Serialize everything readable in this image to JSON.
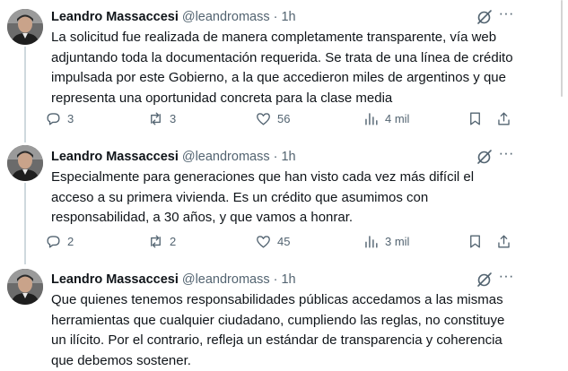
{
  "tweets": [
    {
      "author": "Leandro Massaccesi",
      "handle": "@leandromass",
      "separator": "·",
      "time": "1h",
      "text": "La solicitud fue realizada de manera completamente transparente, vía web adjuntando toda la documentación requerida. Se trata de una línea de crédito impulsada por este Gobierno, a la que accedieron miles de argentinos y que representa una oportunidad concreta para la clase media",
      "replies": "3",
      "reposts": "3",
      "likes": "56",
      "views": "4 mil"
    },
    {
      "author": "Leandro Massaccesi",
      "handle": "@leandromass",
      "separator": "·",
      "time": "1h",
      "text": "Especialmente para generaciones que han visto cada vez más difícil el acceso a su primera vivienda. Es un crédito que asumimos con responsabilidad, a 30 años, y que vamos a honrar.",
      "replies": "2",
      "reposts": "2",
      "likes": "45",
      "views": "3 mil"
    },
    {
      "author": "Leandro Massaccesi",
      "handle": "@leandromass",
      "separator": "·",
      "time": "1h",
      "text": "Que quienes tenemos responsabilidades públicas accedamos a las mismas herramientas que cualquier ciudadano, cumpliendo las reglas, no constituye un ilícito. Por el contrario, refleja un estándar de transparencia y coherencia que debemos sostener."
    }
  ],
  "icons": {
    "reply": "reply-icon",
    "repost": "repost-icon",
    "like": "heart-icon",
    "views": "views-icon",
    "bookmark": "bookmark-icon",
    "share": "share-icon",
    "grok": "grok-icon",
    "more": "more-icon"
  },
  "colors": {
    "text": "#0f1419",
    "secondary": "#536471",
    "divider": "#eff3f4",
    "thread_line": "#cfd9de"
  }
}
